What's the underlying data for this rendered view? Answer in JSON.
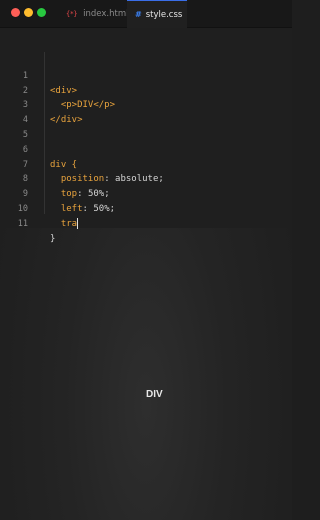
{
  "tabs": [
    {
      "icon": "{*}",
      "label": "index.html",
      "active": false
    },
    {
      "icon": "#",
      "label": "style.css",
      "active": true
    }
  ],
  "editor": {
    "lines": [
      {
        "num": "1",
        "code": "<div>"
      },
      {
        "num": "2",
        "code": "  <p>DIV</p>"
      },
      {
        "num": "3",
        "code": "</div>"
      },
      {
        "num": "4",
        "code": ""
      },
      {
        "num": "5",
        "code": ""
      },
      {
        "num": "6",
        "code": "div {"
      },
      {
        "num": "7",
        "prop": "position",
        "value": " absolute;"
      },
      {
        "num": "8",
        "prop": "top",
        "value": " 50%;"
      },
      {
        "num": "9",
        "prop": "left",
        "value": " 50%;"
      },
      {
        "num": "10",
        "typing": "tra"
      },
      {
        "num": "11",
        "code": "}"
      }
    ]
  },
  "preview": {
    "text": "DIV"
  },
  "colors": {
    "background": "#1e1e1e",
    "keyword": "#e8a33d",
    "text": "#d4d4d4",
    "active_tab_accent": "#3a6ee8"
  }
}
